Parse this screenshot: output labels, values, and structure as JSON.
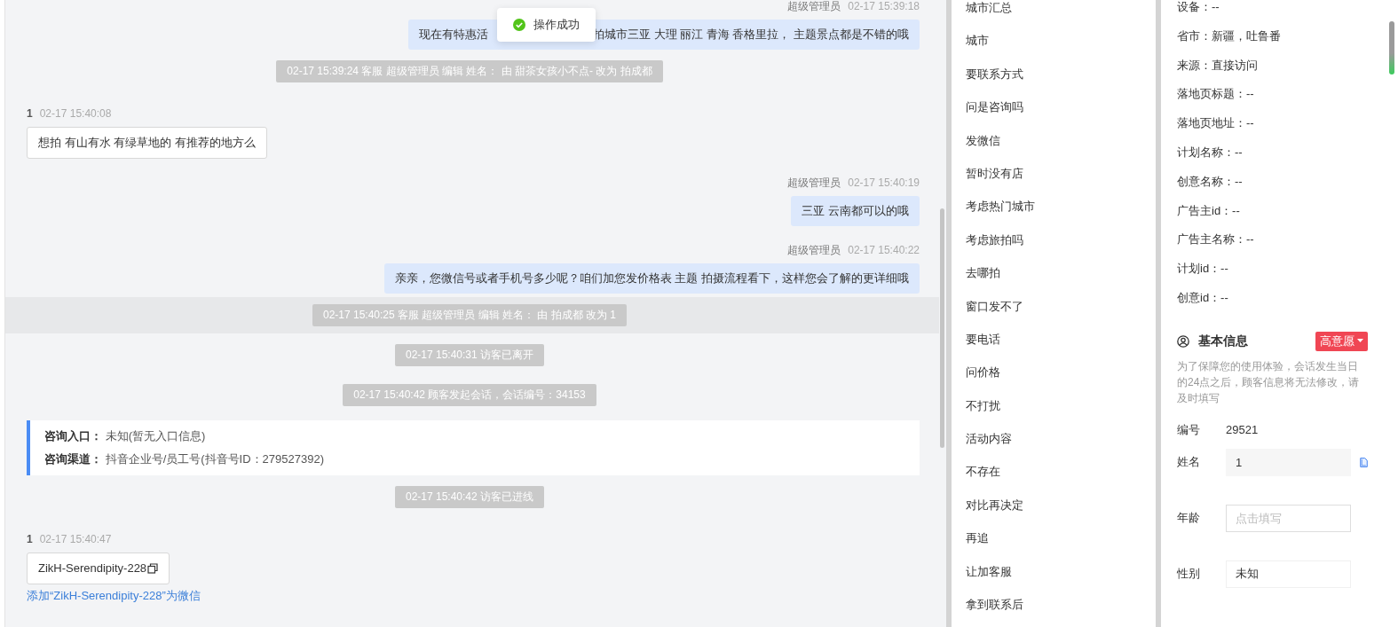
{
  "chat": {
    "messages": [
      {
        "kind": "agent_header",
        "name": "超级管理员",
        "time": "02-17 15:39:18"
      },
      {
        "kind": "agent_bubble",
        "visible_parts": [
          "现在有特惠活",
          "拍城市三亚 大理 丽江 青海 香格里拉， 主题景点都是不错的哦"
        ]
      },
      {
        "kind": "system",
        "text": "02-17 15:39:24 客服 超级管理员 编辑 姓名： 由 甜茶女孩小不点- 改为 拍成都",
        "highlighted": false
      },
      {
        "kind": "customer_header",
        "name": "1",
        "time": "02-17 15:40:08"
      },
      {
        "kind": "customer_bubble",
        "text": "想拍 有山有水  有绿草地的  有推荐的地方么"
      },
      {
        "kind": "agent_header",
        "name": "超级管理员",
        "time": "02-17 15:40:19"
      },
      {
        "kind": "agent_bubble",
        "visible_parts": [
          "三亚 云南都可以的哦"
        ]
      },
      {
        "kind": "agent_header",
        "name": "超级管理员",
        "time": "02-17 15:40:22"
      },
      {
        "kind": "agent_bubble",
        "visible_parts": [
          "亲亲，您微信号或者手机号多少呢？咱们加您发价格表 主题 拍摄流程看下，这样您会了解的更详细哦"
        ]
      },
      {
        "kind": "system",
        "text": "02-17 15:40:25 客服 超级管理员 编辑 姓名： 由 拍成都 改为 1",
        "highlighted": true
      },
      {
        "kind": "system",
        "text": "02-17 15:40:31 访客已离开",
        "highlighted": false
      },
      {
        "kind": "system",
        "text": "02-17 15:40:42 顾客发起会话，会话编号：34153",
        "highlighted": false
      },
      {
        "kind": "source_card",
        "rows": [
          {
            "label": "咨询入口：",
            "value": "未知(暂无入口信息)"
          },
          {
            "label": "咨询渠道：",
            "value": "抖音企业号/员工号(抖音号ID：279527392)"
          }
        ]
      },
      {
        "kind": "system",
        "text": "02-17 15:40:42 访客已进线",
        "highlighted": false
      },
      {
        "kind": "customer_header",
        "name": "1",
        "time": "02-17 15:40:47"
      },
      {
        "kind": "copy_bubble",
        "text": "ZikH-Serendipity-228"
      },
      {
        "kind": "link",
        "text": "添加“ZikH-Serendipity-228”为微信"
      }
    ]
  },
  "toast": {
    "text": "操作成功"
  },
  "tags": [
    "城市汇总",
    "城市",
    "要联系方式",
    "问是咨询吗",
    "发微信",
    "暂时没有店",
    "考虑热门城市",
    "考虑旅拍吗",
    "去哪拍",
    "窗口发不了",
    "要电话",
    "问价格",
    "不打扰",
    "活动内容",
    "不存在",
    "对比再决定",
    "再追",
    "让加客服",
    "拿到联系后"
  ],
  "info": {
    "fields": [
      "设备：--",
      "省市：新疆，吐鲁番",
      "来源：直接访问",
      "落地页标题：--",
      "落地页地址：--",
      "计划名称：--",
      "创意名称：--",
      "广告主id：--",
      "广告主名称：--",
      "计划id：--",
      "创意id：--"
    ],
    "basic": {
      "title": "基本信息",
      "intent": "高意愿",
      "note": "为了保障您的使用体验，会话发生当日的24点之后，顾客信息将无法修改，请及时填写",
      "rows": [
        {
          "kind": "static",
          "label": "编号",
          "value": "29521"
        },
        {
          "kind": "readonly",
          "label": "姓名",
          "value": "1"
        },
        {
          "kind": "input",
          "label": "年龄",
          "placeholder": "点击填写"
        },
        {
          "kind": "select",
          "label": "性别",
          "value": "未知"
        }
      ]
    }
  }
}
